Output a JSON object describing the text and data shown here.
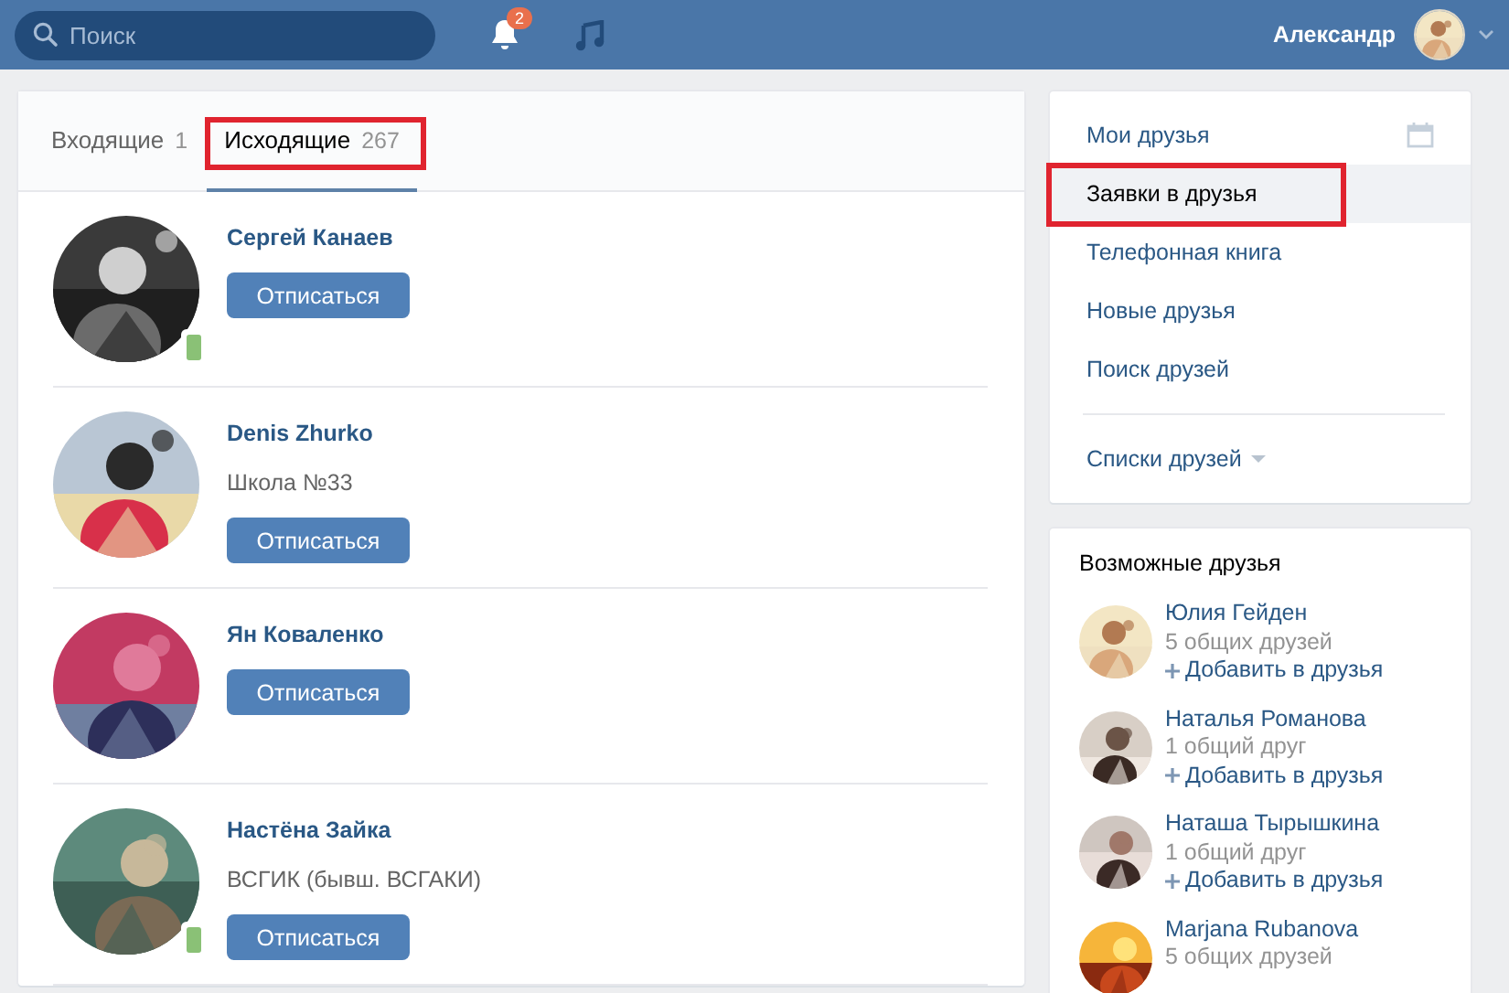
{
  "header": {
    "search": {
      "placeholder": "Поиск"
    },
    "notifications_badge": "2",
    "user_name": "Александр"
  },
  "tabs": [
    {
      "label": "Входящие",
      "count": "1",
      "selected": false,
      "highlighted": false
    },
    {
      "label": "Исходящие",
      "count": "267",
      "selected": true,
      "highlighted": true
    }
  ],
  "requests": [
    {
      "name": "Сергей Канаев",
      "mobile_online": true,
      "button": "Отписаться"
    },
    {
      "name": "Denis Zhurko",
      "subtitle": "Школа №33",
      "mobile_online": false,
      "button": "Отписаться"
    },
    {
      "name": "Ян Коваленко",
      "mobile_online": false,
      "button": "Отписаться"
    },
    {
      "name": "Настёна Зайка",
      "subtitle": "ВСГИК (бывш. ВСГАКИ)",
      "mobile_online": true,
      "button": "Отписаться"
    }
  ],
  "menu": {
    "items": [
      {
        "label": "Мои друзья",
        "selected": false,
        "highlighted": false
      },
      {
        "label": "Заявки в друзья",
        "selected": true,
        "highlighted": true
      },
      {
        "label": "Телефонная книга",
        "selected": false,
        "highlighted": false
      },
      {
        "label": "Новые друзья",
        "selected": false,
        "highlighted": false
      },
      {
        "label": "Поиск друзей",
        "selected": false,
        "highlighted": false
      }
    ],
    "lists_label": "Списки друзей"
  },
  "suggestions": {
    "title": "Возможные друзья",
    "people": [
      {
        "name": "Юлия Гейден",
        "mutual": "5 общих друзей",
        "add": "Добавить в друзья"
      },
      {
        "name": "Наталья Романова",
        "mutual": "1 общий друг",
        "add": "Добавить в друзья"
      },
      {
        "name": "Наташа Тырышкина",
        "mutual": "1 общий друг",
        "add": "Добавить в друзья"
      },
      {
        "name": "Marjana Rubanova",
        "mutual": "5 общих друзей"
      }
    ]
  }
}
